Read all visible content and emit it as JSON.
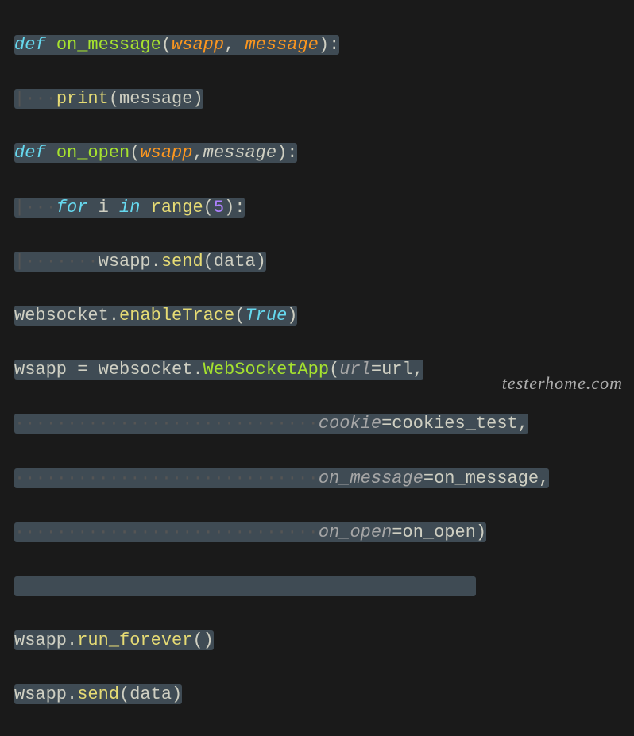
{
  "lines": {
    "l1_def": "def",
    "l1_fn": "on_message",
    "l1_p1": "wsapp",
    "l1_p2": "message",
    "l2_fn": "print",
    "l2_arg": "message",
    "l3_def": "def",
    "l3_fn": "on_open",
    "l3_p1": "wsapp",
    "l3_p2": "message",
    "l4_for": "for",
    "l4_var": "i",
    "l4_in": "in",
    "l4_fn": "range",
    "l4_num": "5",
    "l5_obj": "wsapp",
    "l5_fn": "send",
    "l5_arg": "data",
    "l6_obj": "websocket",
    "l6_fn": "enableTrace",
    "l6_arg": "True",
    "l7_lhs": "wsapp",
    "l7_mod": "websocket",
    "l7_cls": "WebSocketApp",
    "l7_k1": "url",
    "l7_v1": "url",
    "l8_k": "cookie",
    "l8_v": "cookies_test",
    "l9_k": "on_message",
    "l9_v": "on_message",
    "l10_k": "on_open",
    "l10_v": "on_open",
    "l12_obj": "wsapp",
    "l12_fn": "run_forever",
    "l13_obj": "wsapp",
    "l13_fn": "send",
    "l13_arg": "data"
  },
  "watermark": "testerhome.com"
}
